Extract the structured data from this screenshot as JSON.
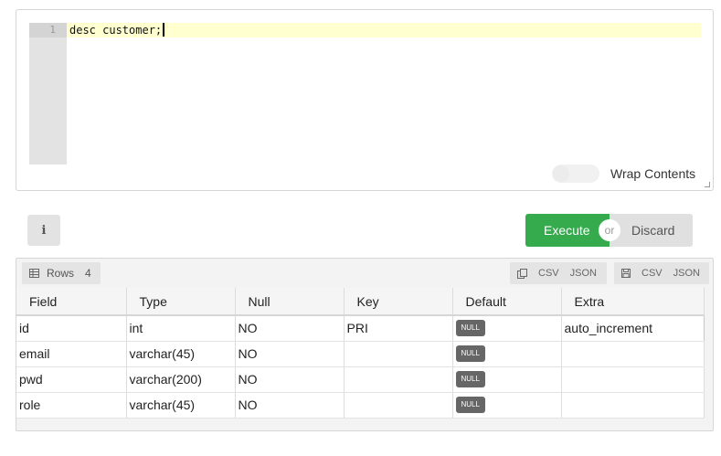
{
  "editor": {
    "line_numbers": [
      "1"
    ],
    "code": "desc customer;",
    "wrap_label": "Wrap Contents"
  },
  "actions": {
    "info_label": "i",
    "execute_label": "Execute",
    "or_label": "or",
    "discard_label": "Discard"
  },
  "results": {
    "rows_label": "Rows",
    "rows_count": "4",
    "copy_icon": "copy-icon",
    "save_icon": "save-icon",
    "csv_label": "CSV",
    "json_label": "JSON",
    "columns": [
      "Field",
      "Type",
      "Null",
      "Key",
      "Default",
      "Extra"
    ],
    "rows": [
      {
        "field": "id",
        "type": "int",
        "null": "NO",
        "key": "PRI",
        "default": "NULL",
        "extra": "auto_increment"
      },
      {
        "field": "email",
        "type": "varchar(45)",
        "null": "NO",
        "key": "",
        "default": "NULL",
        "extra": ""
      },
      {
        "field": "pwd",
        "type": "varchar(200)",
        "null": "NO",
        "key": "",
        "default": "NULL",
        "extra": ""
      },
      {
        "field": "role",
        "type": "varchar(45)",
        "null": "NO",
        "key": "",
        "default": "NULL",
        "extra": ""
      }
    ]
  },
  "colors": {
    "execute": "#35ab4e",
    "null_badge": "#666666",
    "active_line": "#ffffd0"
  }
}
